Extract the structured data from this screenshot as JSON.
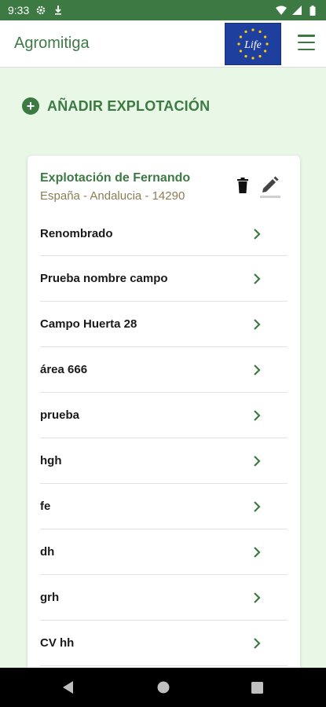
{
  "status_bar": {
    "time": "9:33",
    "icons": [
      "settings-gear-icon",
      "download-arrow-icon",
      "wifi-icon",
      "signal-icon",
      "battery-icon"
    ]
  },
  "app_bar": {
    "title": "Agromitiga",
    "logo": "eu-life-logo",
    "logo_text": "Life",
    "menu_icon": "hamburger-menu-icon"
  },
  "add_farm": {
    "label": "AÑADIR EXPLOTACIÓN",
    "icon": "add-circle-icon"
  },
  "farm_card": {
    "name": "Explotación de Fernando",
    "location": "España - Andalucia - 14290",
    "actions": [
      "delete-icon",
      "edit-icon"
    ],
    "fields": [
      {
        "name": "Renombrado"
      },
      {
        "name": "Prueba nombre campo"
      },
      {
        "name": "Campo Huerta 28"
      },
      {
        "name": "área 666"
      },
      {
        "name": "prueba"
      },
      {
        "name": "hgh"
      },
      {
        "name": "fe"
      },
      {
        "name": "dh"
      },
      {
        "name": "grh"
      },
      {
        "name": "CV hh"
      }
    ]
  },
  "navigation": {
    "buttons": [
      "back-icon",
      "home-icon",
      "recents-icon"
    ]
  },
  "colors": {
    "primary_green": "#3d7a43",
    "background": "#e9f7e6",
    "location_text": "#8a7d55",
    "eu_blue": "#1f3f9e",
    "eu_star": "#ffcc00"
  }
}
